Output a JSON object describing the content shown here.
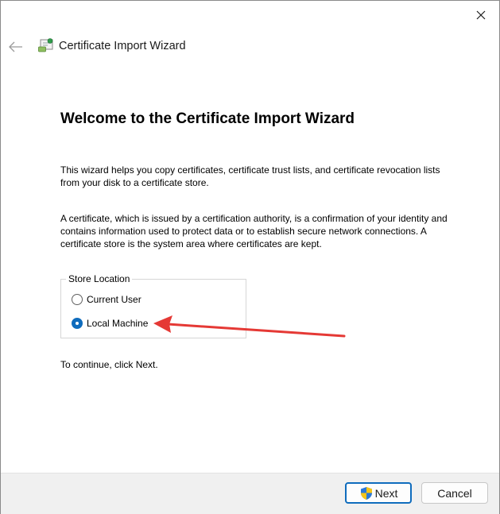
{
  "window": {
    "title": "Certificate Import Wizard"
  },
  "page": {
    "heading": "Welcome to the Certificate Import Wizard",
    "intro": "This wizard helps you copy certificates, certificate trust lists, and certificate revocation lists from your disk to a certificate store.",
    "description": "A certificate, which is issued by a certification authority, is a confirmation of your identity and contains information used to protect data or to establish secure network connections. A certificate store is the system area where certificates are kept.",
    "continue_text": "To continue, click Next."
  },
  "store_location": {
    "legend": "Store Location",
    "options": [
      {
        "label": "Current User",
        "checked": false
      },
      {
        "label": "Local Machine",
        "checked": true
      }
    ]
  },
  "footer": {
    "next_label": "Next",
    "cancel_label": "Cancel"
  },
  "colors": {
    "accent": "#0f6cbd",
    "annotation_arrow": "#e53935",
    "footer_bg": "#f0f0f0"
  },
  "icons": {
    "close": "close-icon",
    "back": "back-arrow-icon",
    "certificate": "certificate-icon",
    "shield": "uac-shield-icon"
  }
}
